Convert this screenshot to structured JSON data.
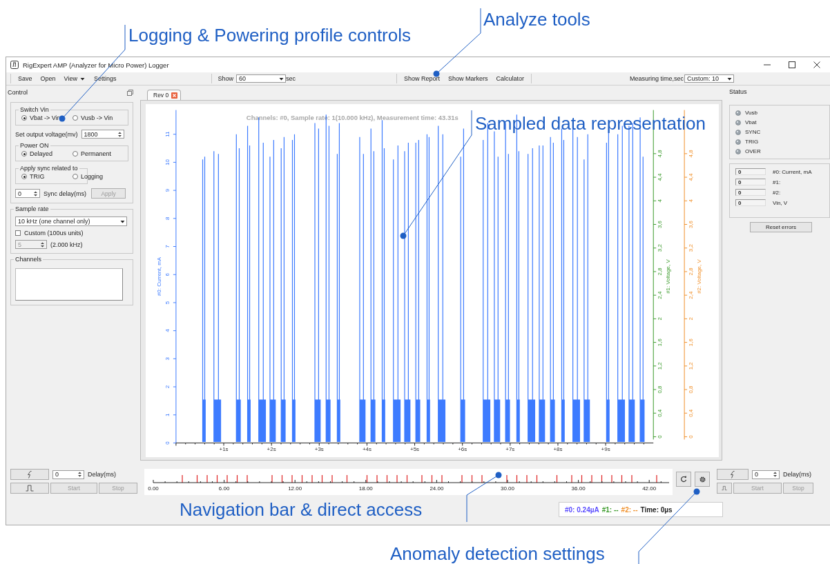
{
  "annotations": [
    {
      "text": "Logging & Powering profile controls"
    },
    {
      "text": "Analyze tools"
    },
    {
      "text": "Sampled data representation"
    },
    {
      "text": "Navigation bar & direct access"
    },
    {
      "text": "Anomaly detection settings"
    }
  ],
  "window": {
    "title": "RigExpert AMP (Analyzer for Micro Power) Logger"
  },
  "toolbar": {
    "menu": [
      "Save",
      "Open",
      "View",
      "Settings"
    ],
    "show_label": "Show",
    "show_value": "60",
    "show_unit": "sec",
    "tools": [
      "Show Report",
      "Show Markers",
      "Calculator"
    ],
    "measuring_label": "Measuring time,sec",
    "measuring_value": "Custom: 10"
  },
  "control": {
    "title": "Control",
    "switch_vin": {
      "title": "Switch Vin",
      "options": [
        {
          "label": "Vbat -> Vin",
          "selected": true
        },
        {
          "label": "Vusb -> Vin",
          "selected": false
        }
      ]
    },
    "output_voltage": {
      "label": "Set output voltage(mv)",
      "value": "1800"
    },
    "power_on": {
      "title": "Power ON",
      "options": [
        {
          "label": "Delayed",
          "selected": true
        },
        {
          "label": "Permanent",
          "selected": false
        }
      ]
    },
    "sync": {
      "title": "Apply sync related to",
      "options": [
        {
          "label": "TRIG",
          "selected": true
        },
        {
          "label": "Logging",
          "selected": false
        }
      ]
    },
    "sync_delay": {
      "value": "0",
      "label": "Sync delay(ms)"
    },
    "apply_button": {
      "label": "Apply",
      "disabled": true
    },
    "sample_rate": {
      "title": "Sample rate",
      "value": "10 kHz (one channel only)",
      "custom": {
        "label": "Custom (100us units)",
        "checked": false
      },
      "custom_value": "5",
      "custom_disabled": true,
      "rate": "(2.000 kHz)"
    },
    "channels": {
      "title": "Channels"
    }
  },
  "tabs": [
    {
      "label": "Rev 0",
      "selected": true
    }
  ],
  "plot": {
    "title": "Channels: #0,  Sample rate: 1(10.000 kHz), Measurement time: 43.31s",
    "left_axis": {
      "label": "#0: Current, mA",
      "ticks": [
        "0",
        "1",
        "2",
        "3",
        "4",
        "5",
        "6",
        "7",
        "8",
        "9",
        "10",
        "11"
      ]
    },
    "green_axis": {
      "label": "#1: Voltage, V",
      "ticks": [
        "0",
        "0,4",
        "0,8",
        "1,2",
        "1,6",
        "2",
        "2,4",
        "2,8",
        "3,2",
        "3,6",
        "4",
        "4,4",
        "4,8"
      ]
    },
    "orange_axis": {
      "label": "#2: Voltage, V",
      "ticks": [
        "0",
        "0,4",
        "0,8",
        "1,2",
        "1,6",
        "2",
        "2,4",
        "2,8",
        "3,2",
        "3,6",
        "4",
        "4,4",
        "4,8"
      ]
    },
    "x_ticks": [
      "+1s",
      "+2s",
      "+3s",
      "+4s",
      "+5s",
      "+6s",
      "+7s",
      "+8s",
      "+9s"
    ]
  },
  "navigation": {
    "ticks": [
      "0.00",
      "6.00",
      "12.00",
      "18.00",
      "24.00",
      "30.00",
      "36.00",
      "42.00"
    ]
  },
  "left_controls": {
    "delay_value": "0",
    "delay_label": "Delay(ms)",
    "start": {
      "label": "Start",
      "disabled": true
    },
    "stop": {
      "label": "Stop",
      "disabled": true
    }
  },
  "right_controls": {
    "delay_value": "0",
    "delay_label": "Delay(ms)",
    "start": {
      "label": "Start",
      "disabled": true
    },
    "stop": {
      "label": "Stop",
      "disabled": true
    }
  },
  "status": {
    "title": "Status",
    "leds": [
      {
        "label": "Vusb",
        "on": false
      },
      {
        "label": "Vbat",
        "on": false
      },
      {
        "label": "SYNC",
        "on": false
      },
      {
        "label": "TRIG",
        "on": false
      },
      {
        "label": "OVER",
        "on": false
      }
    ],
    "readouts": [
      {
        "value": "0",
        "label": "#0: Current, mA"
      },
      {
        "value": "0",
        "label": "#1:"
      },
      {
        "value": "0",
        "label": "#2:"
      },
      {
        "value": "0",
        "label": "Vin, V"
      }
    ],
    "reset_button": "Reset errors"
  },
  "status_bar": [
    {
      "text": "#0: 0.24µA",
      "color": "#5a4cff"
    },
    {
      "text": "#1: --",
      "color": "#3a9a2a"
    },
    {
      "text": "#2: --",
      "color": "#f0902a"
    },
    {
      "text": "Time: 0µs",
      "color": "#222222"
    }
  ]
}
